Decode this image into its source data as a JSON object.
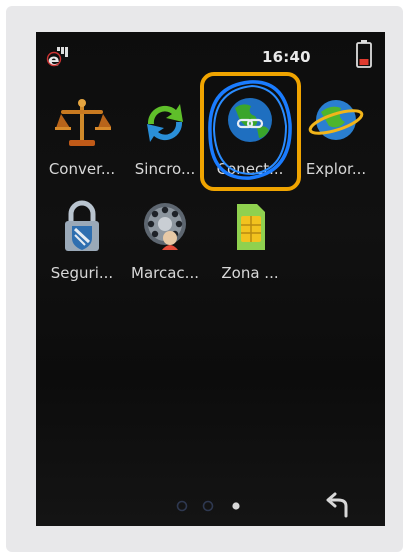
{
  "status_bar": {
    "network_icon": "data-e-icon",
    "time": "16:40",
    "battery_icon": "battery-low-icon",
    "battery_color": "#e03a2e"
  },
  "apps": [
    {
      "label": "Conver...",
      "icon": "scales-icon"
    },
    {
      "label": "Sincro...",
      "icon": "sync-arrows-icon"
    },
    {
      "label": "Conect...",
      "icon": "globe-link-icon",
      "highlighted": true
    },
    {
      "label": "Explor...",
      "icon": "globe-orbit-icon"
    },
    {
      "label": "Seguri...",
      "icon": "padlock-shield-icon"
    },
    {
      "label": "Marcac...",
      "icon": "rotary-dial-icon"
    },
    {
      "label": "Zona ...",
      "icon": "sim-card-icon"
    }
  ],
  "pager": {
    "pages": 3,
    "current": 3
  },
  "highlight_color": "#f0a400",
  "back_icon": "back-arrow-icon"
}
